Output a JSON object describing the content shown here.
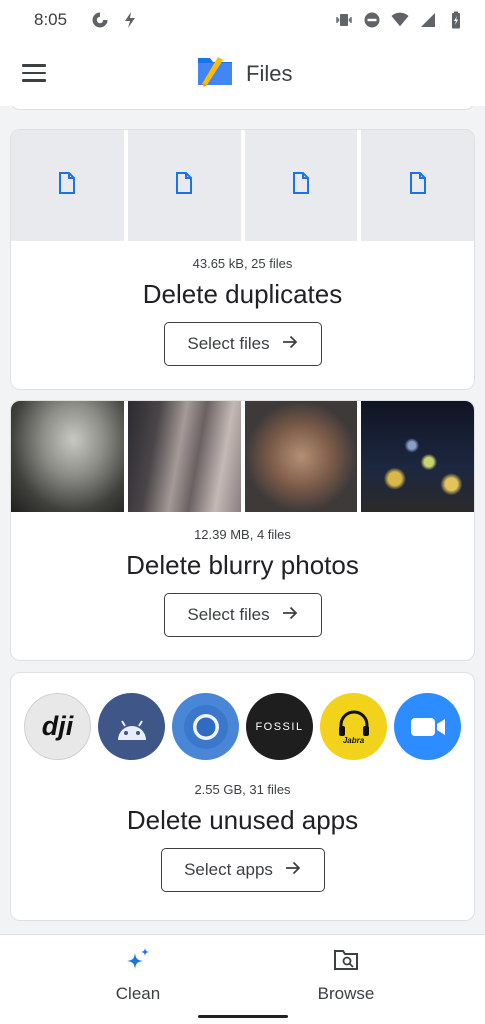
{
  "status_bar": {
    "time": "8:05",
    "icons_left": [
      "data-saver-icon",
      "bolt-icon"
    ],
    "icons_right": [
      "vibrate-icon",
      "do-not-disturb-icon",
      "wifi-icon",
      "signal-icon",
      "battery-icon"
    ]
  },
  "app_bar": {
    "title": "Files",
    "menu_icon": "menu-icon",
    "logo_icon": "files-logo-icon"
  },
  "cards": {
    "duplicates": {
      "meta": "43.65 kB, 25 files",
      "title": "Delete duplicates",
      "button_label": "Select files",
      "thumbnail_icon": "document-icon"
    },
    "blurry": {
      "meta": "12.39 MB, 4 files",
      "title": "Delete blurry photos",
      "button_label": "Select files"
    },
    "unused_apps": {
      "meta": "2.55 GB, 31 files",
      "title": "Delete unused apps",
      "button_label": "Select apps",
      "apps": [
        {
          "icon": "dji-app-icon",
          "logo_text": "dji"
        },
        {
          "icon": "android-app-icon"
        },
        {
          "icon": "chrome-app-icon"
        },
        {
          "icon": "fossil-app-icon",
          "logo_text": "FOSSIL"
        },
        {
          "icon": "jabra-app-icon",
          "logo_text": "Jabra"
        },
        {
          "icon": "zoom-app-icon"
        }
      ]
    }
  },
  "bottom_nav": {
    "clean_label": "Clean",
    "browse_label": "Browse"
  },
  "colors": {
    "accent_blue": "#1a73e8",
    "text_primary": "#202124",
    "text_secondary": "#3c4043",
    "background": "#f1f3f4"
  }
}
